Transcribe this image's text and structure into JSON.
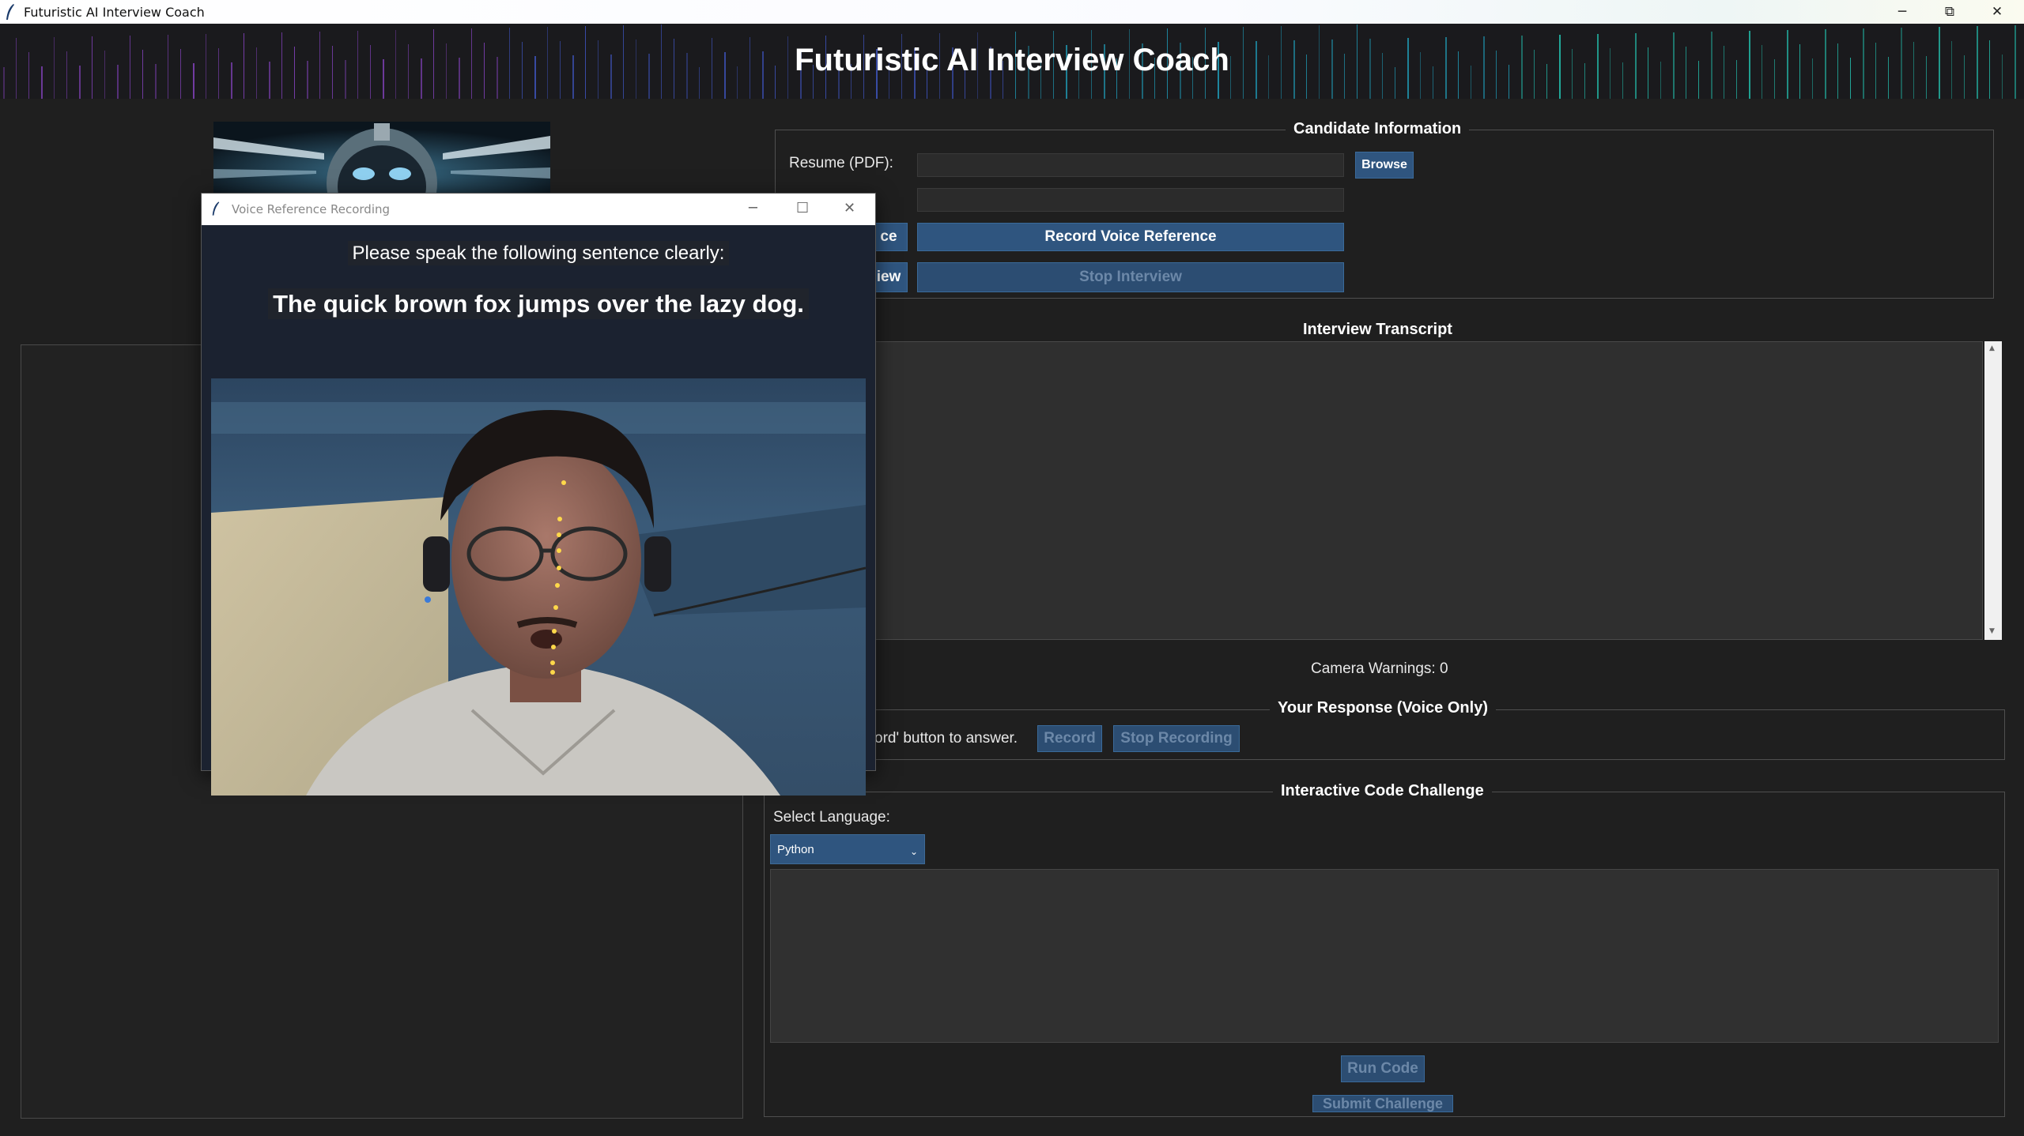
{
  "window": {
    "title": "Futuristic AI Interview Coach",
    "controls": {
      "minimize": "─",
      "maximize": "⧉",
      "close": "✕"
    }
  },
  "header": {
    "title": "Futuristic AI Interview Coach"
  },
  "candidate_info": {
    "title": "Candidate Information",
    "resume_label": "Resume (PDF):",
    "resume_value": "",
    "browse_label": "Browse",
    "second_field_value": "",
    "record_ref_left_label": "ce",
    "record_voice_reference_label": "Record Voice Reference",
    "start_left_label": "iew",
    "stop_interview_label": "Stop Interview"
  },
  "transcript": {
    "title": "Interview Transcript",
    "content": ""
  },
  "camera": {
    "warnings_text": "Camera Warnings: 0"
  },
  "response": {
    "title": "Your Response (Voice Only)",
    "hint_text": "ord' button to answer.",
    "record_label": "Record",
    "stop_recording_label": "Stop Recording"
  },
  "code_challenge": {
    "title": "Interactive Code Challenge",
    "select_language_label": "Select Language:",
    "language_selected": "Python",
    "code": "",
    "run_code_label": "Run Code",
    "submit_label": "Submit Challenge"
  },
  "popup": {
    "title": "Voice Reference Recording",
    "controls": {
      "minimize": "─",
      "maximize": "☐",
      "close": "✕"
    },
    "instruction": "Please speak the following sentence clearly:",
    "sentence": "The quick brown fox jumps over the lazy dog."
  },
  "colors": {
    "background": "#1f1f1f",
    "button": "#2f557f",
    "popup_body": "#1b2230",
    "banner_stripes": [
      "#7b3fb0",
      "#3b4fb0",
      "#1f8fa8",
      "#22b0a0"
    ]
  }
}
